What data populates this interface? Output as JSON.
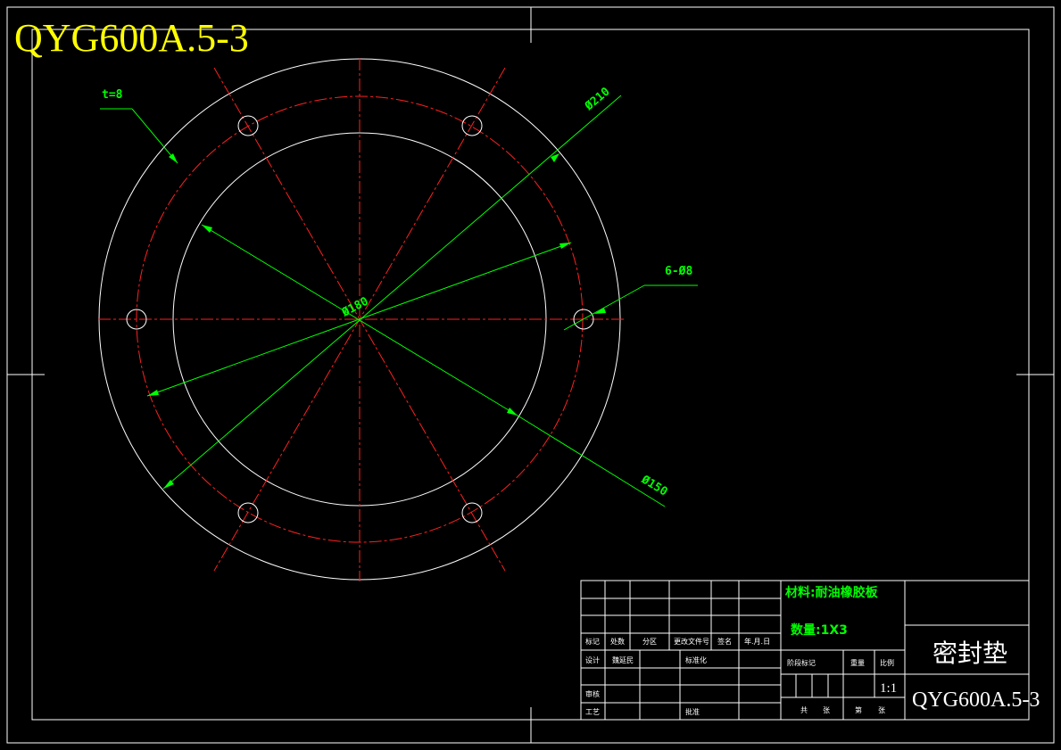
{
  "drawing_code": "QYG600A.5-3",
  "dimensions": {
    "thickness": "t=8",
    "outer_diameter": "Ø210",
    "inner_diameter": "Ø180",
    "bolt_circle": "Ø150",
    "holes": "6-Ø8"
  },
  "title_block": {
    "material": "材料:耐油橡胶板",
    "quantity": "数量:1X3",
    "part_name": "密封垫",
    "drawing_number": "QYG600A.5-3",
    "scale": "1:1",
    "row_labels": {
      "mark": "标记",
      "count": "处数",
      "zone": "分区",
      "change_doc": "更改文件号",
      "signature": "签名",
      "date": "年.月.日",
      "design": "设计",
      "designer": "魏延民",
      "standard": "标准化",
      "review": "审核",
      "process": "工艺",
      "approve": "批准",
      "stage_mark": "阶段标记",
      "weight": "重量",
      "scale_label": "比例",
      "total": "共",
      "sheet": "张",
      "page": "第",
      "sheet2": "张"
    }
  },
  "colors": {
    "outline": "#ffffff",
    "center_lines": "#ff2020",
    "dimensions": "#00ff00",
    "code_title": "#ffff00"
  }
}
